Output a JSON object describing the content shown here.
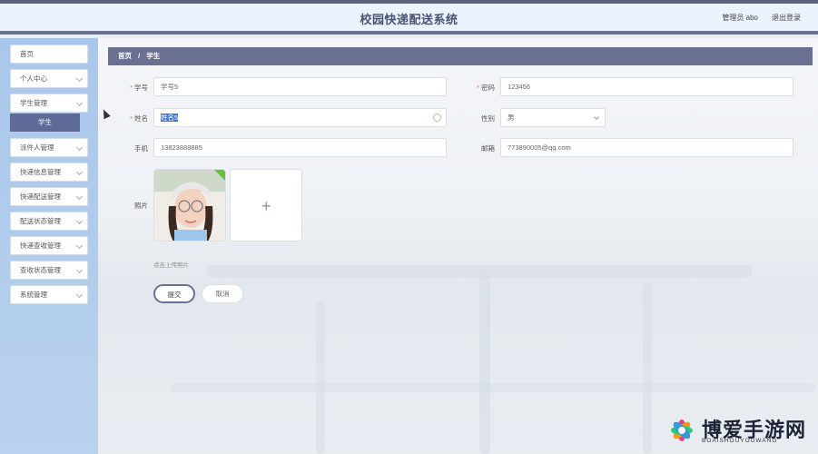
{
  "header": {
    "title": "校园快递配送系统",
    "user": "管理员 abo",
    "logout": "退出登录"
  },
  "sidebar": {
    "items": [
      {
        "label": "首页",
        "has_chevron": false
      },
      {
        "label": "个人中心",
        "has_chevron": true
      },
      {
        "label": "学生管理",
        "has_chevron": true
      },
      {
        "label": "派件人管理",
        "has_chevron": true
      },
      {
        "label": "快递信息管理",
        "has_chevron": true
      },
      {
        "label": "快递配送管理",
        "has_chevron": true
      },
      {
        "label": "配送状态管理",
        "has_chevron": true
      },
      {
        "label": "快递查收管理",
        "has_chevron": true
      },
      {
        "label": "查收状态管理",
        "has_chevron": true
      },
      {
        "label": "系统管理",
        "has_chevron": true
      }
    ],
    "submenu_active": "学生"
  },
  "breadcrumb": {
    "home": "首页",
    "separator": "/",
    "current": "学生"
  },
  "form": {
    "student_id": {
      "label": "学号",
      "required": "*",
      "value": "学号5"
    },
    "password": {
      "label": "密码",
      "required": "*",
      "value": "123456"
    },
    "name": {
      "label": "姓名",
      "required": "*",
      "value": "姓名5"
    },
    "gender": {
      "label": "性别",
      "value": "男"
    },
    "phone": {
      "label": "手机",
      "value": "13823888885"
    },
    "email": {
      "label": "邮箱",
      "value": "773890005@qq.com"
    },
    "photo": {
      "label": "照片",
      "hint": "点击上传照片"
    }
  },
  "buttons": {
    "submit": "提交",
    "cancel": "取消"
  },
  "watermark": {
    "text": "博爱手游网",
    "sub": "BOAISHOUYOUWANG"
  },
  "colors": {
    "accent": "#6a7090",
    "sidebar_bg": "#a9c7ea",
    "submenu_active_bg": "#5f6a96",
    "required": "#f56c6c"
  }
}
